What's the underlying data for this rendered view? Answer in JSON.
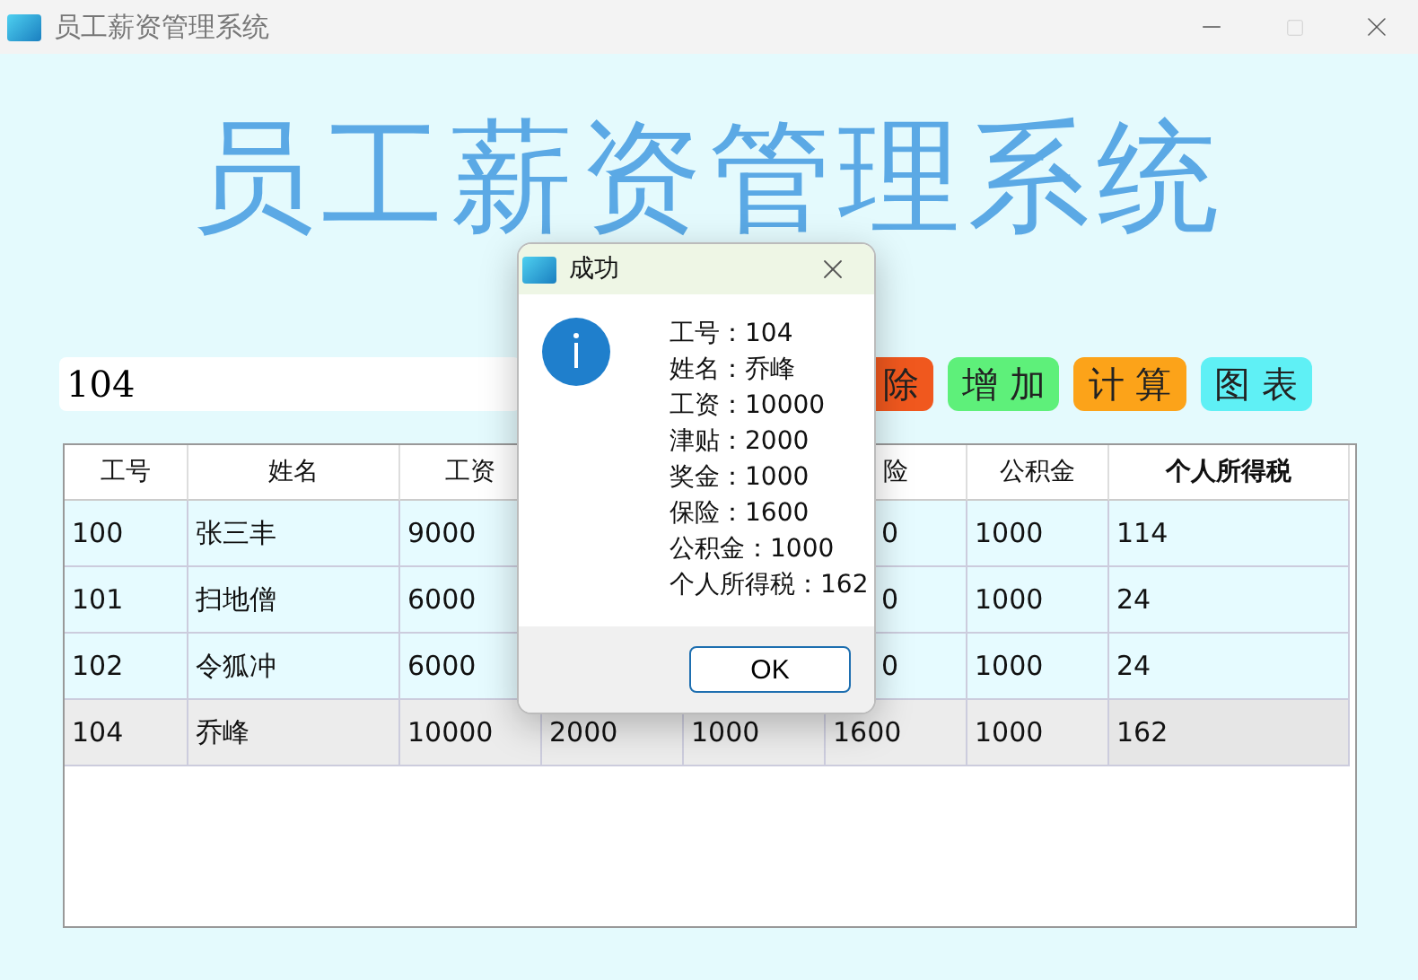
{
  "window": {
    "title": "员工薪资管理系统"
  },
  "heading": "员工薪资管理系统",
  "search": {
    "value": "104"
  },
  "buttons": [
    {
      "label": "除",
      "color": "#f0581e",
      "cut": true
    },
    {
      "label": "增 加",
      "color": "#5ef07a",
      "cut": false
    },
    {
      "label": "计 算",
      "color": "#fca319",
      "cut": false
    },
    {
      "label": "图 表",
      "color": "#5ff0f5",
      "cut": false
    }
  ],
  "table": {
    "columns": [
      {
        "label": "工号",
        "bold": false
      },
      {
        "label": "姓名",
        "bold": false
      },
      {
        "label": "工资",
        "bold": false
      },
      null,
      null,
      {
        "label": "险",
        "bold": false
      },
      {
        "label": "公积金",
        "bold": false
      },
      {
        "label": "个人所得税",
        "bold": true
      }
    ],
    "rows": [
      {
        "selected": false,
        "cells": [
          "100",
          "张三丰",
          "9000",
          null,
          null,
          {
            "text": "0",
            "cut": true
          },
          "1000",
          "114"
        ]
      },
      {
        "selected": false,
        "cells": [
          "101",
          "扫地僧",
          "6000",
          null,
          null,
          {
            "text": "0",
            "cut": true
          },
          "1000",
          "24"
        ]
      },
      {
        "selected": false,
        "cells": [
          "102",
          "令狐冲",
          "6000",
          null,
          null,
          {
            "text": "0",
            "cut": true
          },
          "1000",
          "24"
        ]
      },
      {
        "selected": true,
        "cells": [
          "104",
          "乔峰",
          "10000",
          "2000",
          "1000",
          "1600",
          "1000",
          "162"
        ]
      }
    ]
  },
  "dialog": {
    "title": "成功",
    "lines": [
      "工号：104",
      "姓名：乔峰",
      "工资：10000",
      "津贴：2000",
      "奖金：1000",
      "保险：1600",
      "公积金：1000",
      "个人所得税：162"
    ],
    "button": "OK"
  }
}
